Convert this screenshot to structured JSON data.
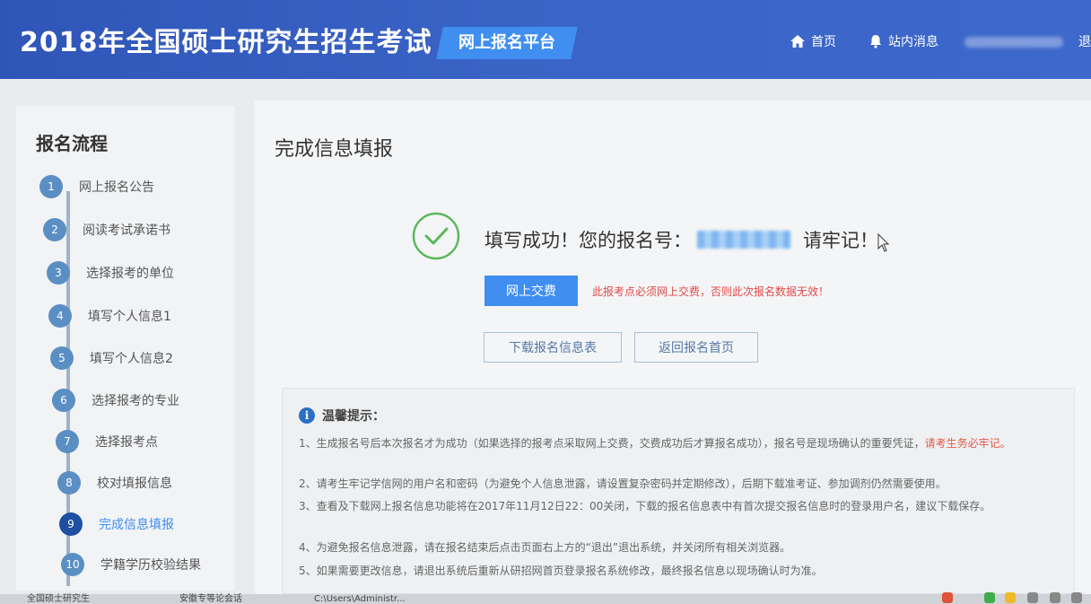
{
  "header": {
    "title": "2018年全国硕士研究生招生考试",
    "platform": "网上报名平台",
    "nav_home": "首页",
    "nav_messages": "站内消息",
    "nav_logout": "退"
  },
  "sidebar": {
    "title": "报名流程",
    "steps": [
      {
        "num": "1",
        "label": "网上报名公告"
      },
      {
        "num": "2",
        "label": "阅读考试承诺书"
      },
      {
        "num": "3",
        "label": "选择报考的单位"
      },
      {
        "num": "4",
        "label": "填写个人信息1"
      },
      {
        "num": "5",
        "label": "填写个人信息2"
      },
      {
        "num": "6",
        "label": "选择报考的专业"
      },
      {
        "num": "7",
        "label": "选择报考点"
      },
      {
        "num": "8",
        "label": "校对填报信息"
      },
      {
        "num": "9",
        "label": "完成信息填报"
      },
      {
        "num": "10",
        "label": "学籍学历校验结果"
      }
    ]
  },
  "main": {
    "title": "完成信息填报",
    "success_prefix": "填写成功！您的报名号：",
    "success_suffix": "请牢记！",
    "pay_button": "网上交费",
    "pay_warning": "此报考点必须网上交费，否则此次报名数据无效！",
    "download_button": "下载报名信息表",
    "back_button": "返回报名首页"
  },
  "tips": {
    "title": "温馨提示：",
    "items": [
      {
        "text": "1、生成报名号后本次报名才为成功（如果选择的报考点采取网上交费，交费成功后才算报名成功），报名号是现场确认的重要凭证，",
        "emphasis": "请考生务必牢记。"
      },
      {
        "text": "2、请考生牢记学信网的用户名和密码（为避免个人信息泄露，请设置复杂密码并定期修改），后期下载准考证、参加调剂仍然需要使用。"
      },
      {
        "text": "3、查看及下载网上报名信息功能将在2017年11月12日22：00关闭，下载的报名信息表中有首次提交报名信息时的登录用户名，建议下载保存。"
      },
      {
        "text": "4、为避免报名信息泄露，请在报名结束后点击页面右上方的“退出”退出系统，并关闭所有相关浏览器。"
      },
      {
        "text": "5、如果需要更改信息，请退出系统后重新从研招网首页登录报名系统修改，最终报名信息以现场确认时为准。"
      }
    ]
  },
  "taskbar": {
    "item1": "全国硕士研究生",
    "item2": "安徽专等论会话",
    "item3": "C:\\Users\\Administr..."
  },
  "colors": {
    "header_blue": "#3a63c6",
    "accent_blue": "#3f8ef0",
    "success_green": "#5cb85c",
    "warning_red": "#e24a4a"
  }
}
